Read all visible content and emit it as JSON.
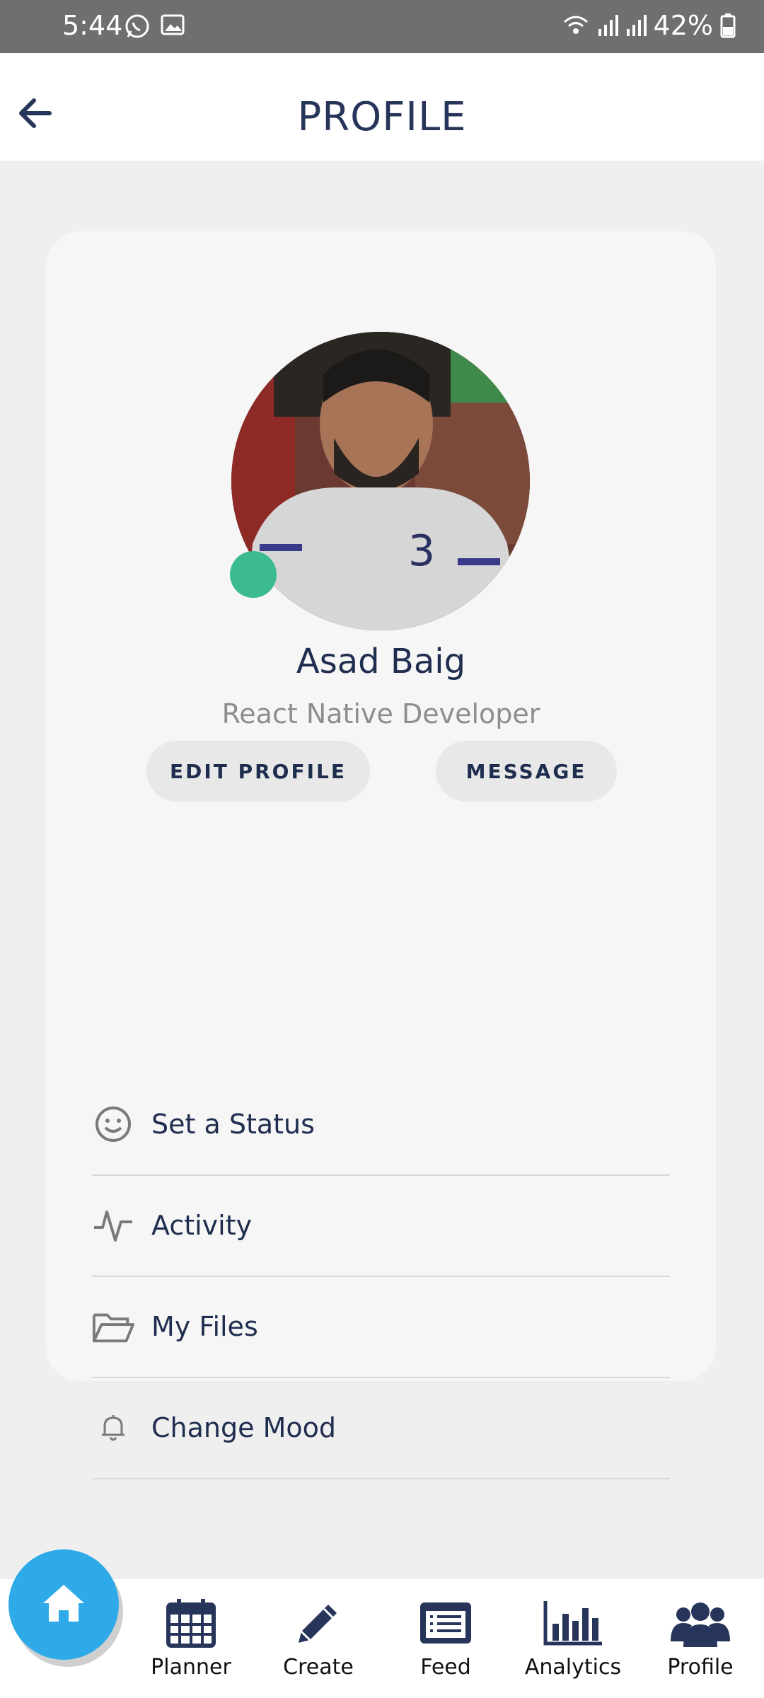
{
  "status_bar": {
    "time": "5:44",
    "battery": "42%",
    "left_icons": [
      "whatsapp-icon",
      "gallery-icon"
    ],
    "right_icons": [
      "wifi-icon",
      "signal-icon",
      "signal-icon",
      "battery-icon"
    ]
  },
  "header": {
    "title": "PROFILE"
  },
  "profile": {
    "name": "Asad Baig",
    "role": "React Native Developer",
    "online": true,
    "colors": {
      "online": "#3cbb8e"
    }
  },
  "actions": {
    "edit_label": "EDIT PROFILE",
    "message_label": "MESSAGE"
  },
  "menu": {
    "items": [
      {
        "label": "Set a Status",
        "icon": "smile-icon"
      },
      {
        "label": "Activity",
        "icon": "activity-icon"
      },
      {
        "label": "My Files",
        "icon": "folder-icon"
      },
      {
        "label": "Change Mood",
        "icon": "bell-icon"
      }
    ]
  },
  "nav": {
    "items": [
      {
        "label": "Planner",
        "icon": "calendar-icon"
      },
      {
        "label": "Create",
        "icon": "pencil-icon"
      },
      {
        "label": "Feed",
        "icon": "feed-icon"
      },
      {
        "label": "Analytics",
        "icon": "chart-icon"
      },
      {
        "label": "Profile",
        "icon": "users-icon"
      }
    ],
    "home_icon": "home-icon",
    "colors": {
      "accent": "#2eaae8",
      "icon": "#27355a"
    }
  }
}
